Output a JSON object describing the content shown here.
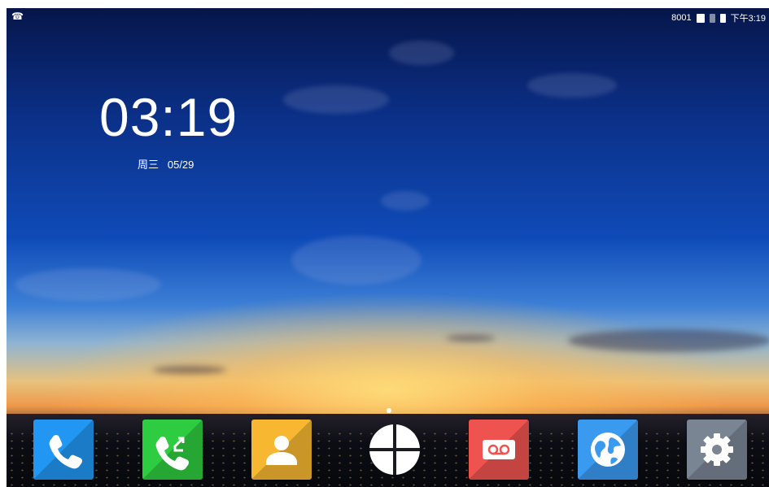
{
  "statusbar": {
    "left_icon": "phone-icon",
    "extension": "8001",
    "time": "下午3:19"
  },
  "clock": {
    "time": "03:19",
    "weekday": "周三",
    "date": "05/29"
  },
  "dock": [
    {
      "name": "phone",
      "icon": "phone-icon",
      "color": "#2196f3"
    },
    {
      "name": "call-transfer",
      "icon": "phone-transfer-icon",
      "color": "#2ecc40"
    },
    {
      "name": "contacts",
      "icon": "person-icon",
      "color": "#f7b731"
    },
    {
      "name": "app-launcher",
      "icon": "app-drawer-icon",
      "color": "#ffffff"
    },
    {
      "name": "voicemail",
      "icon": "voicemail-icon",
      "color": "#ef5350"
    },
    {
      "name": "browser",
      "icon": "globe-icon",
      "color": "#3a9af0"
    },
    {
      "name": "settings",
      "icon": "gear-icon",
      "color": "#7a8594"
    }
  ]
}
